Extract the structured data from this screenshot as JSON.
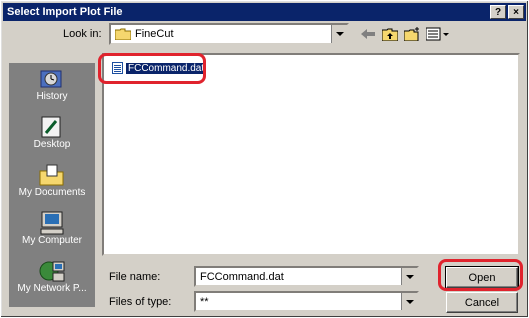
{
  "window": {
    "title": "Select Import Plot File",
    "help_label": "?",
    "close_label": "×"
  },
  "lookin": {
    "label": "Look in:",
    "value": "FineCut"
  },
  "places": [
    {
      "label": "History",
      "icon": "history-icon"
    },
    {
      "label": "Desktop",
      "icon": "desktop-icon"
    },
    {
      "label": "My Documents",
      "icon": "my-documents-icon"
    },
    {
      "label": "My Computer",
      "icon": "my-computer-icon"
    },
    {
      "label": "My Network P...",
      "icon": "network-icon"
    }
  ],
  "files": [
    {
      "name": "FCCommand.dat"
    }
  ],
  "form": {
    "filename_label": "File name:",
    "filename_value": "FCCommand.dat",
    "filetype_label": "Files of type:",
    "filetype_value": "**"
  },
  "buttons": {
    "open": "Open",
    "cancel": "Cancel"
  },
  "colors": {
    "highlight": "#e0232d",
    "title_bar": "#0a246a"
  }
}
